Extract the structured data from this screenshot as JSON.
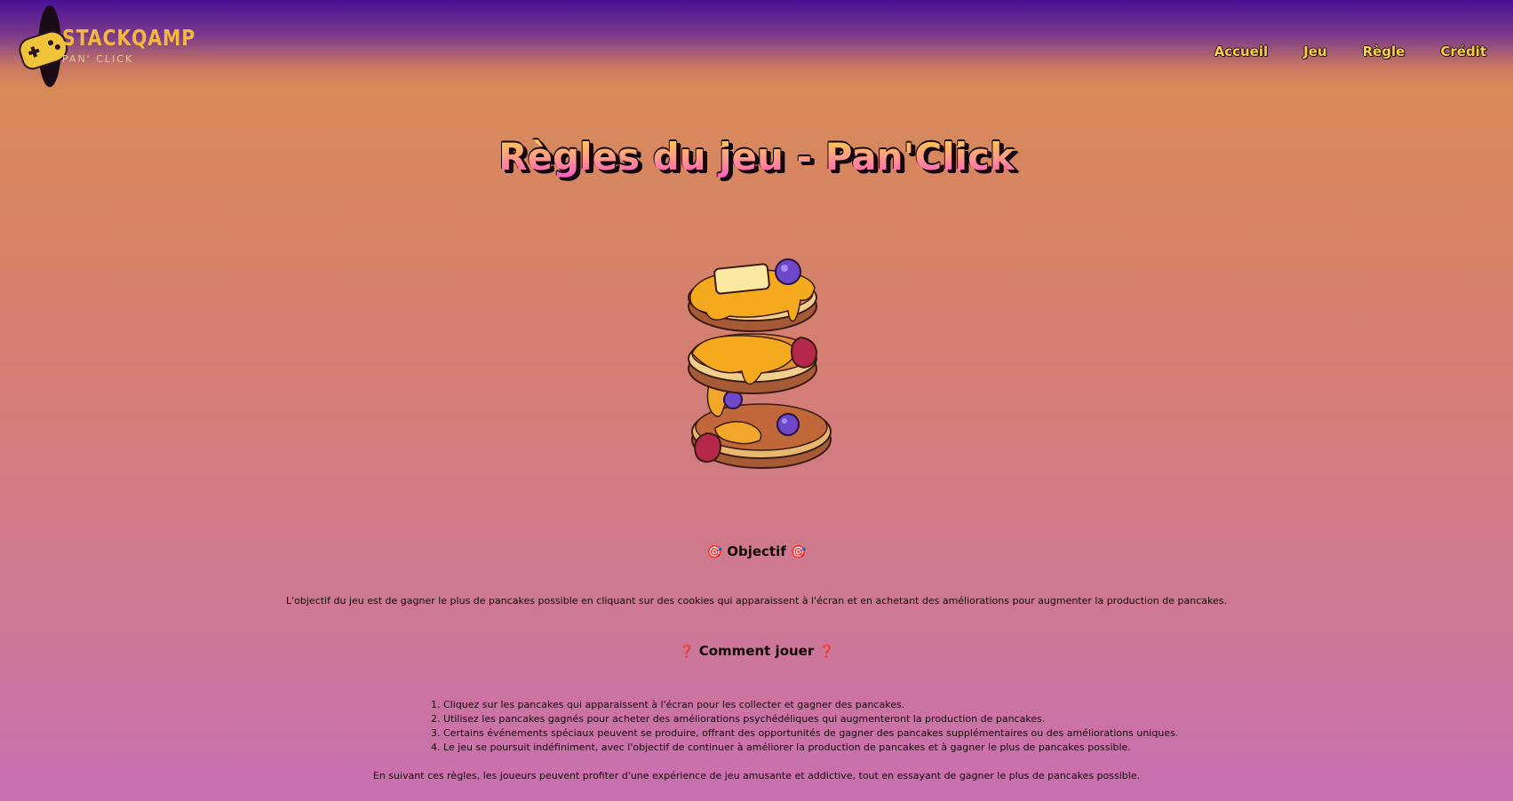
{
  "header": {
    "logo": {
      "name": "STACKQAMP",
      "subtitle": "PAN' CLICK"
    },
    "nav": [
      {
        "label": "Accueil"
      },
      {
        "label": "Jeu"
      },
      {
        "label": "Règle"
      },
      {
        "label": "Crédit"
      }
    ],
    "colors": {
      "nav_text": "#f6d23c",
      "logo_text": "#f3b83d"
    }
  },
  "page": {
    "title": "Règles du jeu - Pan'Click",
    "illustration": "pancake-stack-icon"
  },
  "sections": {
    "objective": {
      "emoji_left": "🎯",
      "heading": "Objectif",
      "emoji_right": "🎯",
      "text": "L'objectif du jeu est de gagner le plus de pancakes possible en cliquant sur des cookies qui apparaissent à l'écran et en achetant des améliorations pour augmenter la production de pancakes."
    },
    "how_to_play": {
      "emoji_left": "❓",
      "heading": "Comment jouer",
      "emoji_right": "❓",
      "steps": [
        "1. Cliquez sur les pancakes qui apparaissent à l'écran pour les collecter et gagner des pancakes.",
        "2. Utilisez les pancakes gagnés pour acheter des améliorations psychédéliques qui augmenteront la production de pancakes.",
        "3. Certains événements spéciaux peuvent se produire, offrant des opportunités de gagner des pancakes supplémentaires ou des améliorations uniques.",
        "4. Le jeu se poursuit indéfiniment, avec l'objectif de continuer à améliorer la production de pancakes et à gagner le plus de pancakes possible."
      ],
      "closing": "En suivant ces règles, les joueurs peuvent profiter d'une expérience de jeu amusante et addictive, tout en essayant de gagner le plus de pancakes possible."
    }
  }
}
